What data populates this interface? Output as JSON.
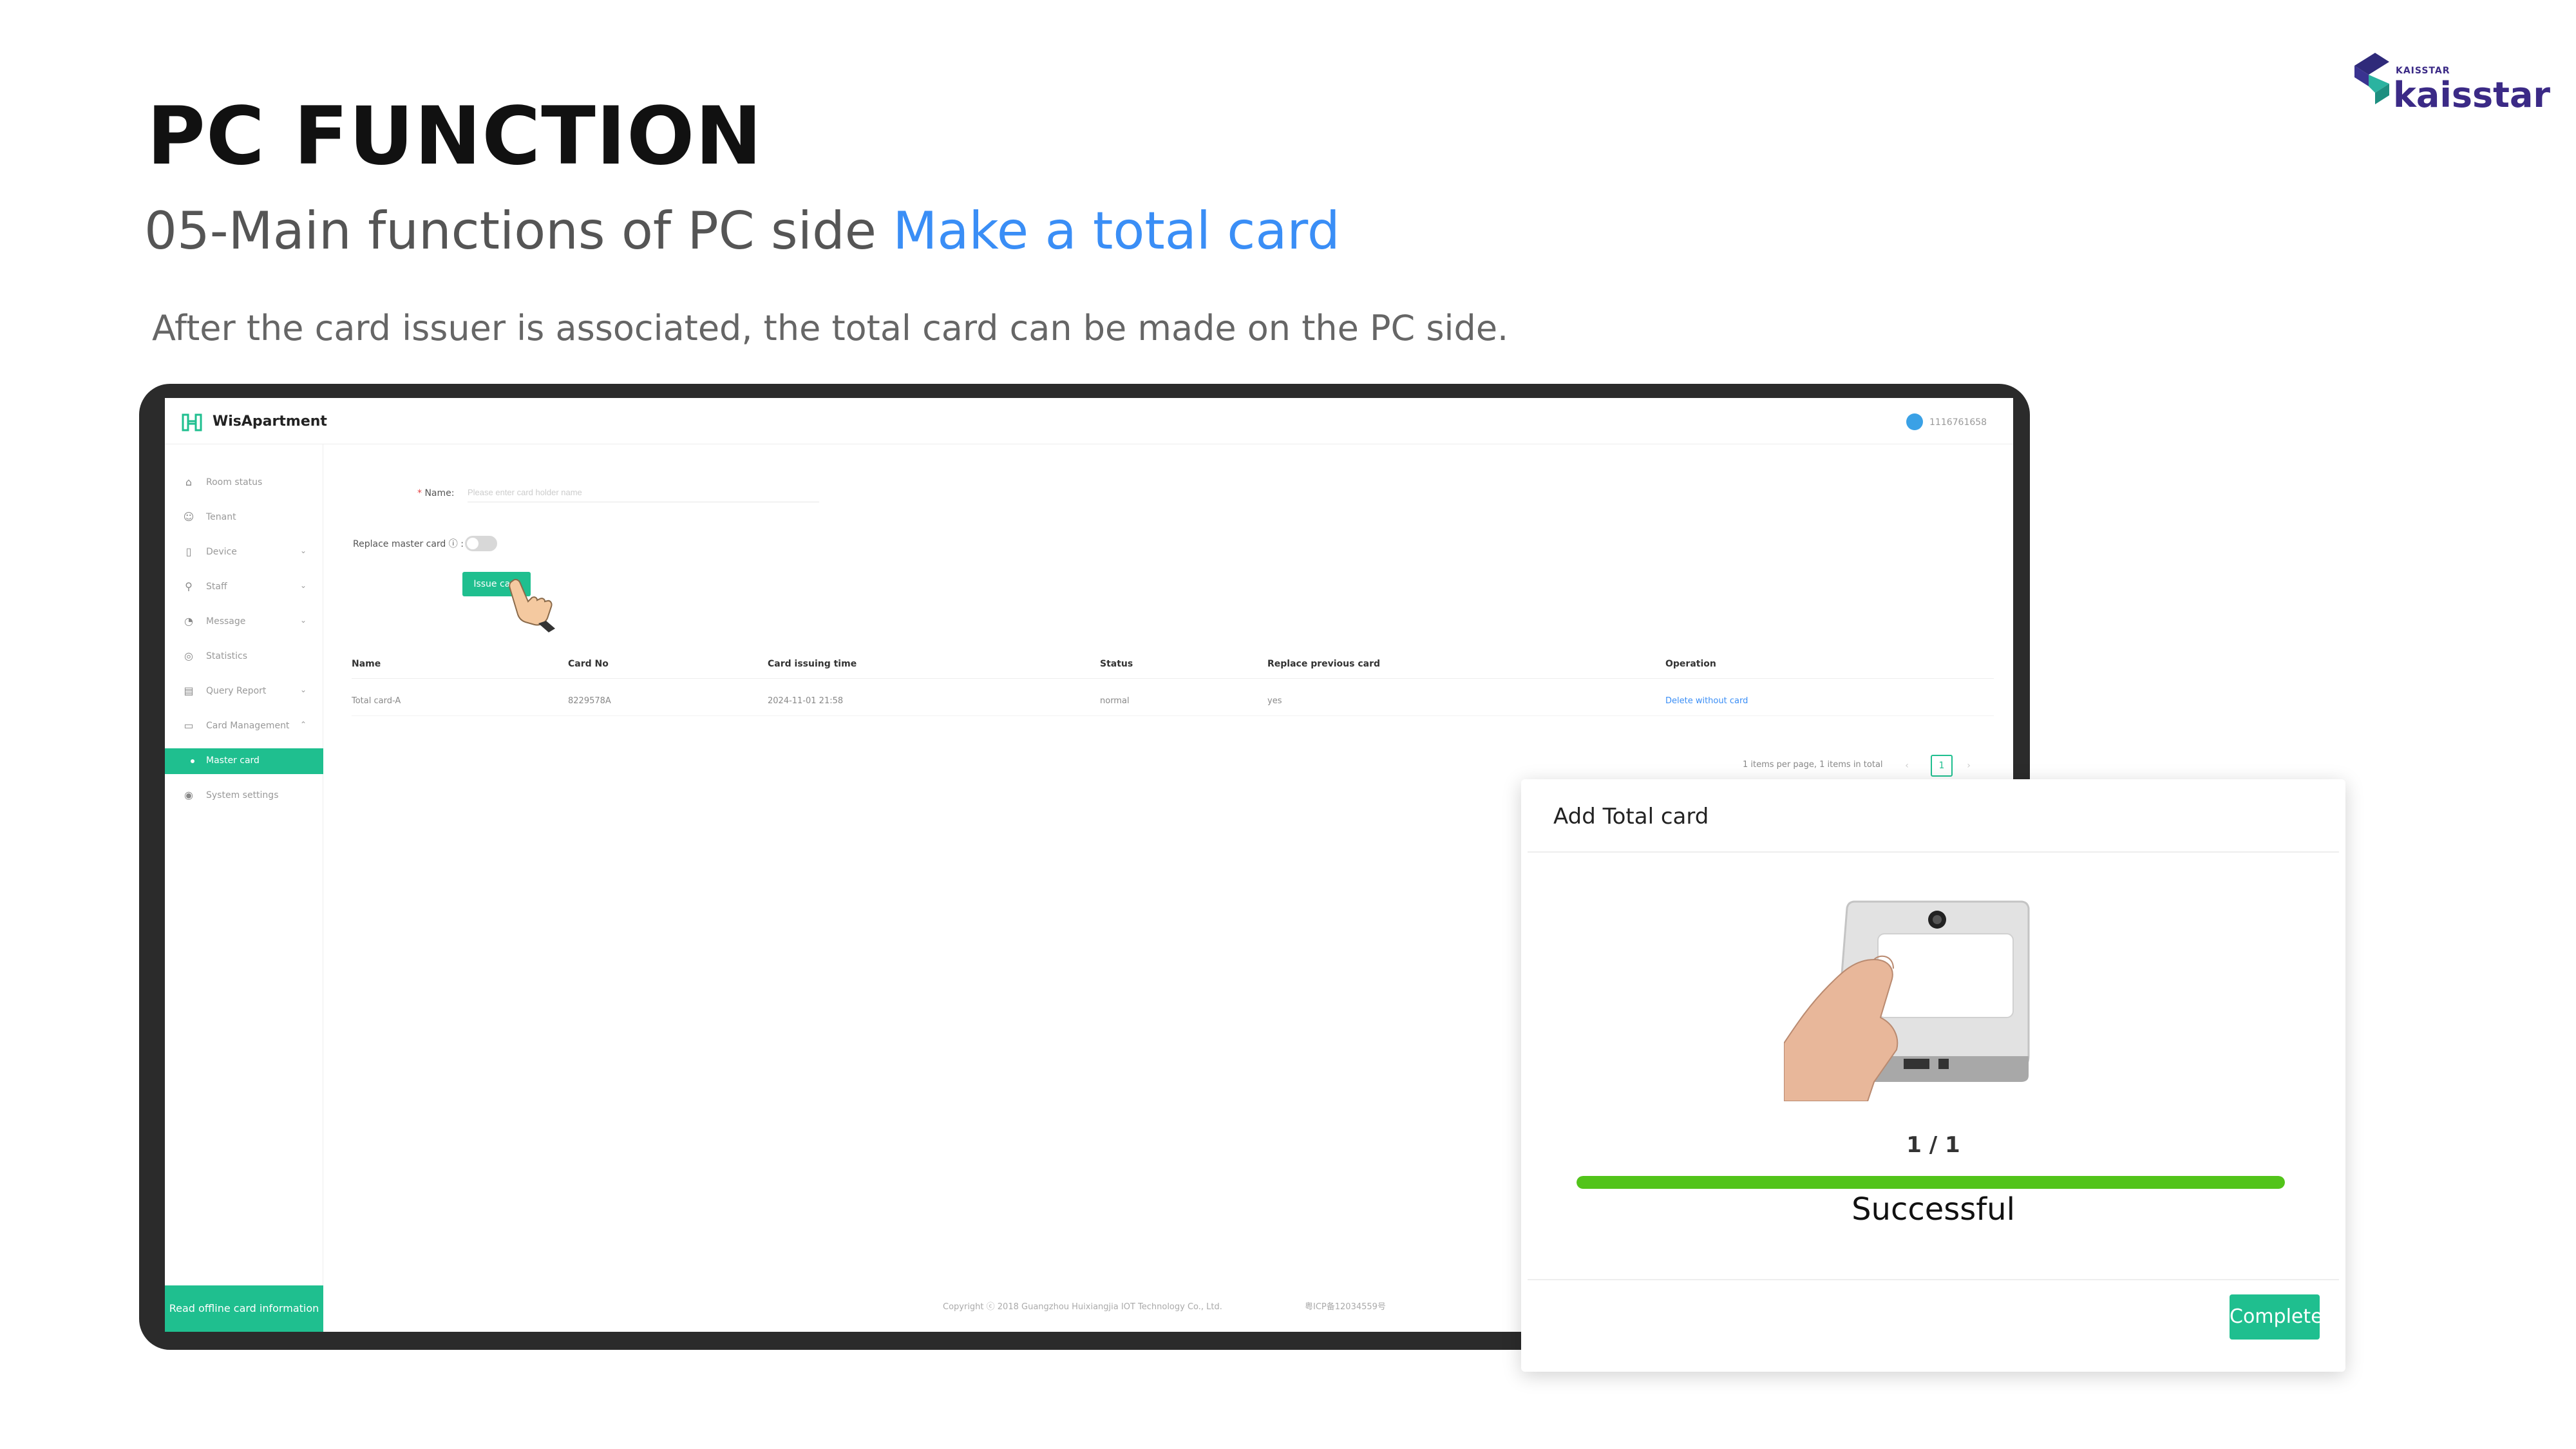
{
  "header": {
    "title": "PC FUNCTION",
    "subtitle_prefix": "05-Main functions of PC side ",
    "subtitle_highlight": "Make a total card",
    "description": "After the card issuer is associated, the total card can be made on the PC side."
  },
  "logo": {
    "small": "KAISSTAR",
    "name": "kaisstar"
  },
  "app": {
    "name": "WisApartment",
    "user_id": "1116761658",
    "sidebar": [
      {
        "label": "Room status",
        "icon": "home-icon"
      },
      {
        "label": "Tenant",
        "icon": "user-icon"
      },
      {
        "label": "Device",
        "icon": "device-icon",
        "chevron": "⌄"
      },
      {
        "label": "Staff",
        "icon": "staff-icon",
        "chevron": "⌄"
      },
      {
        "label": "Message",
        "icon": "bell-icon",
        "chevron": "⌄"
      },
      {
        "label": "Statistics",
        "icon": "chart-icon"
      },
      {
        "label": "Query Report",
        "icon": "report-icon",
        "chevron": "⌄"
      },
      {
        "label": "Card Management",
        "icon": "card-icon",
        "chevron": "⌃"
      },
      {
        "label": "Master card",
        "active": true
      },
      {
        "label": "System settings",
        "icon": "settings-icon"
      }
    ],
    "offline_button": "Read offline card information",
    "form": {
      "name_label": "Name",
      "name_placeholder": "Please enter card holder name",
      "replace_label": "Replace master card",
      "issue_button": "Issue card"
    },
    "table": {
      "columns": [
        "Name",
        "Card No",
        "Card issuing time",
        "Status",
        "Replace previous card",
        "Operation"
      ],
      "rows": [
        {
          "name": "Total card-A",
          "card_no": "8229578A",
          "time": "2024-11-01 21:58",
          "status": "normal",
          "replace": "yes",
          "operation": "Delete without card"
        }
      ]
    },
    "pagination": {
      "summary": "1 items per page, 1 items in total",
      "prev": "‹",
      "current": "1",
      "next": "›"
    },
    "footer": {
      "copyright": "Copyright ⓒ 2018 Guangzhou Huixiangjia IOT Technology Co., Ltd.",
      "icp": "粤ICP备12034559号"
    }
  },
  "modal": {
    "title": "Add Total card",
    "progress_text": "1 / 1",
    "progress_fraction": 1.0,
    "status": "Successful",
    "complete_button": "Complete"
  },
  "colors": {
    "accent": "#1fbf8f",
    "highlight_blue": "#3a8ef6",
    "progress_green": "#52c41a",
    "brand_purple": "#3b2a86"
  }
}
